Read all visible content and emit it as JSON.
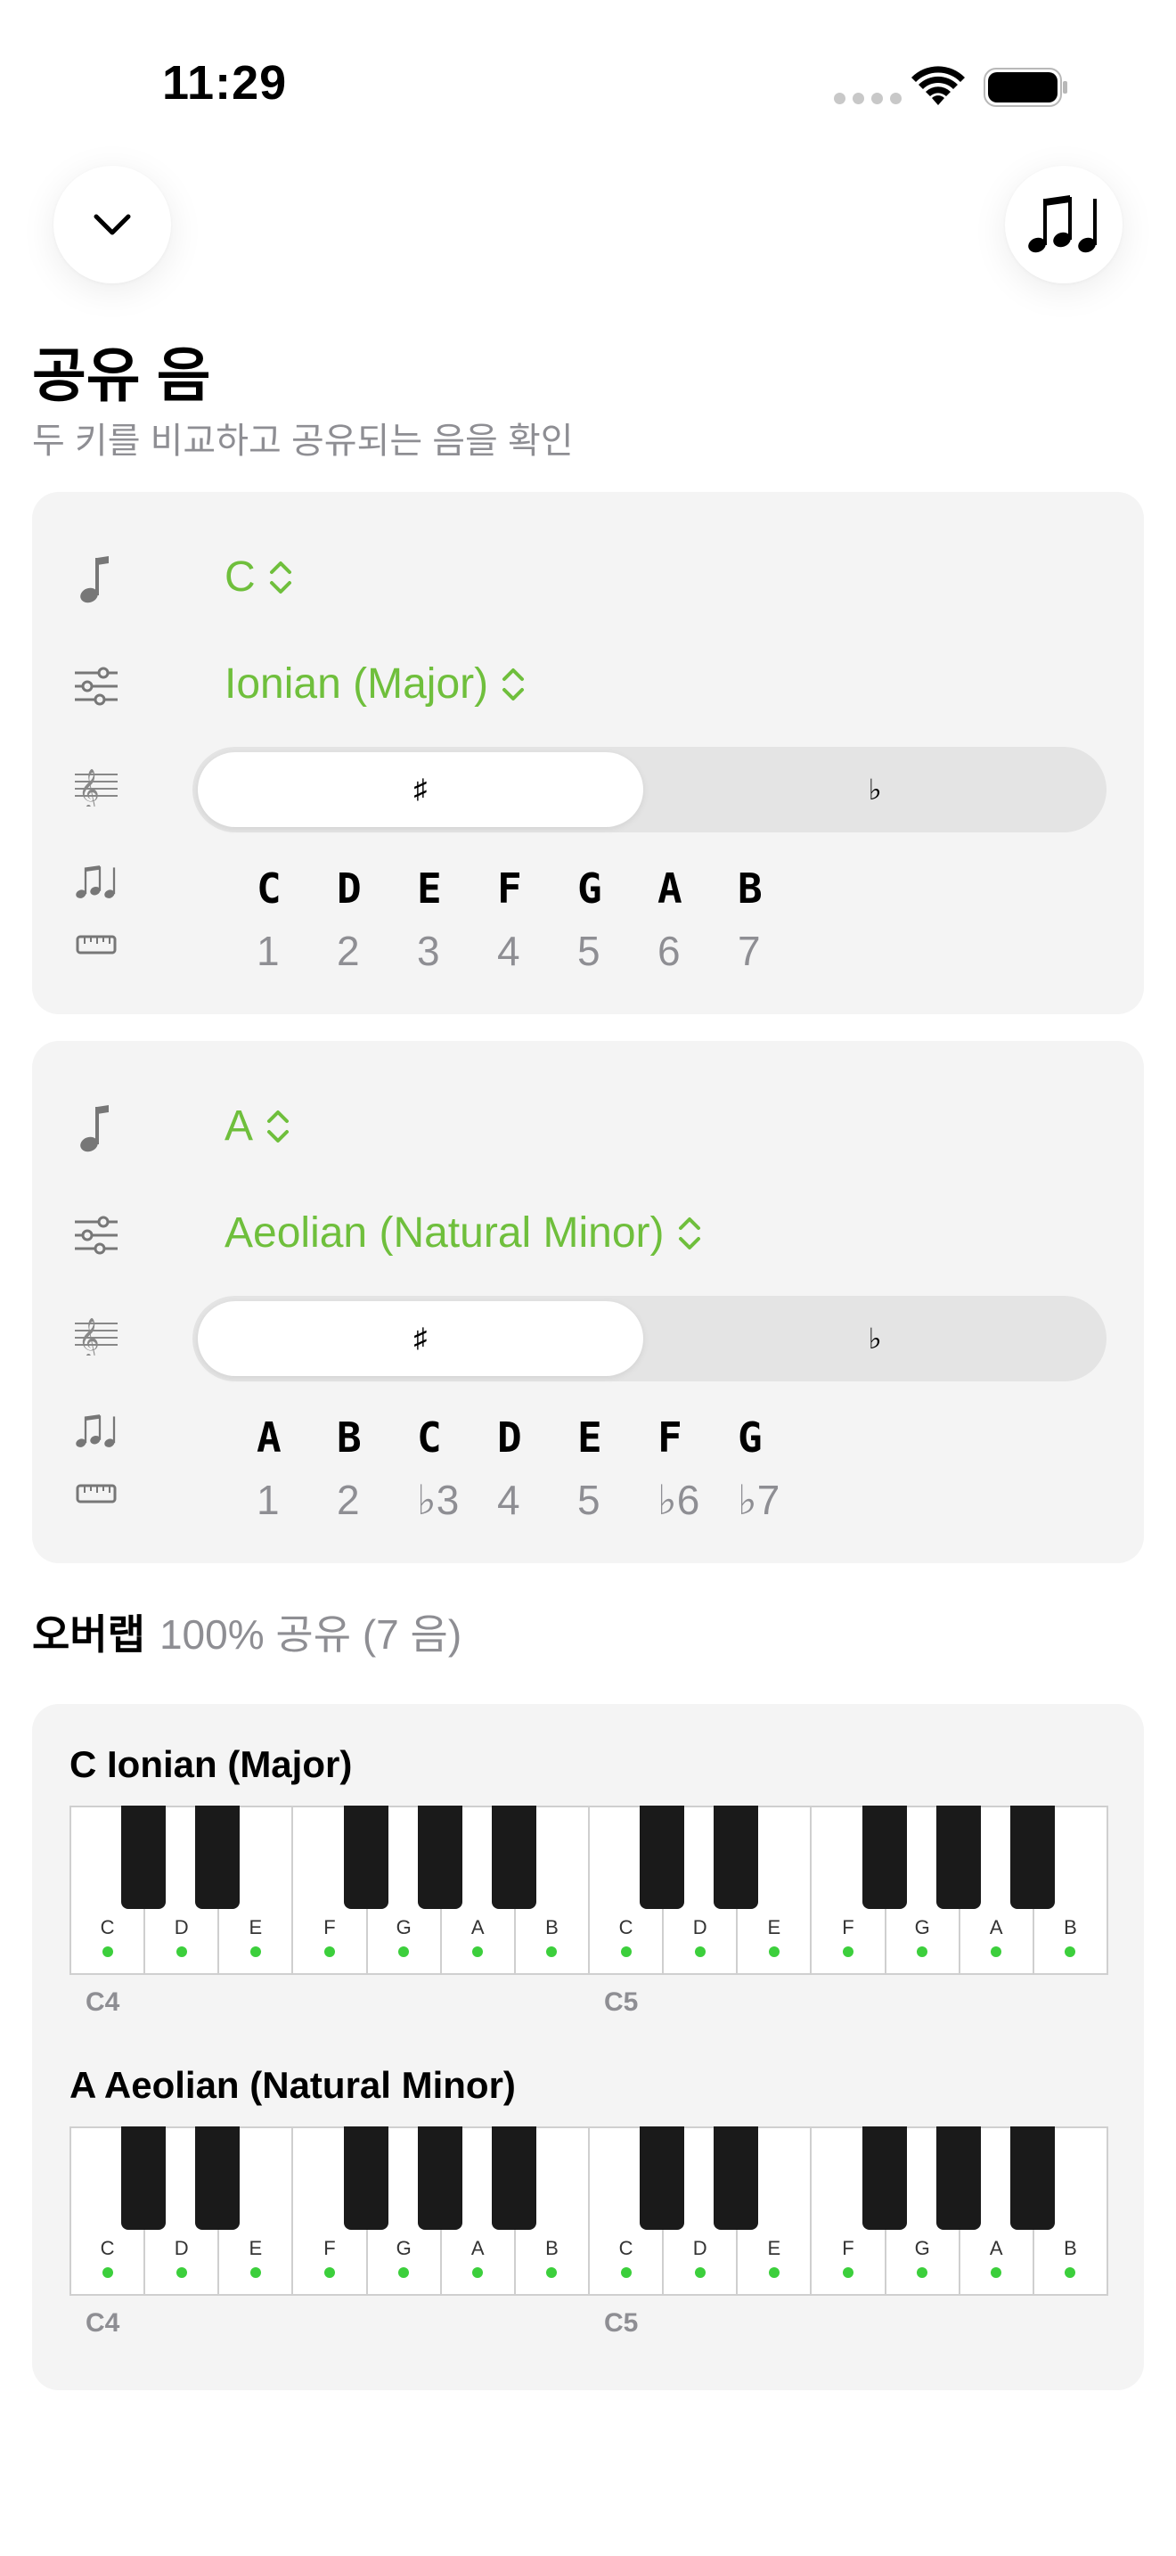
{
  "status_bar": {
    "time": "11:29"
  },
  "header": {
    "title": "공유 음",
    "subtitle": "두 키를 비교하고 공유되는 음을 확인"
  },
  "key1": {
    "root": "C",
    "mode": "Ionian (Major)",
    "accidentals": {
      "sharp": "♯",
      "flat": "♭",
      "selected": "sharp"
    },
    "notes": [
      "C",
      "D",
      "E",
      "F",
      "G",
      "A",
      "B"
    ],
    "degrees": [
      "1",
      "2",
      "3",
      "4",
      "5",
      "6",
      "7"
    ]
  },
  "key2": {
    "root": "A",
    "mode": "Aeolian (Natural Minor)",
    "accidentals": {
      "sharp": "♯",
      "flat": "♭",
      "selected": "sharp"
    },
    "notes": [
      "A",
      "B",
      "C",
      "D",
      "E",
      "F",
      "G"
    ],
    "degrees": [
      "1",
      "2",
      "♭3",
      "4",
      "5",
      "♭6",
      "♭7"
    ]
  },
  "overlap": {
    "label": "오버랩",
    "value": "100% 공유 (7 음)"
  },
  "keyboards": [
    {
      "title": "C Ionian (Major)",
      "white_keys": [
        "C",
        "D",
        "E",
        "F",
        "G",
        "A",
        "B",
        "C",
        "D",
        "E",
        "F",
        "G",
        "A",
        "B"
      ],
      "in_scale": [
        true,
        true,
        true,
        true,
        true,
        true,
        true,
        true,
        true,
        true,
        true,
        true,
        true,
        true
      ],
      "octave_labels": [
        "C4",
        "C5"
      ]
    },
    {
      "title": "A Aeolian (Natural Minor)",
      "white_keys": [
        "C",
        "D",
        "E",
        "F",
        "G",
        "A",
        "B",
        "C",
        "D",
        "E",
        "F",
        "G",
        "A",
        "B"
      ],
      "in_scale": [
        true,
        true,
        true,
        true,
        true,
        true,
        true,
        true,
        true,
        true,
        true,
        true,
        true,
        true
      ],
      "octave_labels": [
        "C4",
        "C5"
      ]
    }
  ],
  "colors": {
    "accent": "#6fbf3c",
    "scale_dot": "#3ccf3c",
    "card": "#f4f4f4",
    "secondary_text": "#8e8e93"
  },
  "icons": {
    "collapse": "chevron-down-icon",
    "notes": "music-notes-icon",
    "root_row": "music-note-icon",
    "mode_row": "sliders-icon",
    "accidental_row": "treble-clef-icon",
    "notes_row": "music-notes-icon",
    "degrees_row": "ruler-icon"
  }
}
